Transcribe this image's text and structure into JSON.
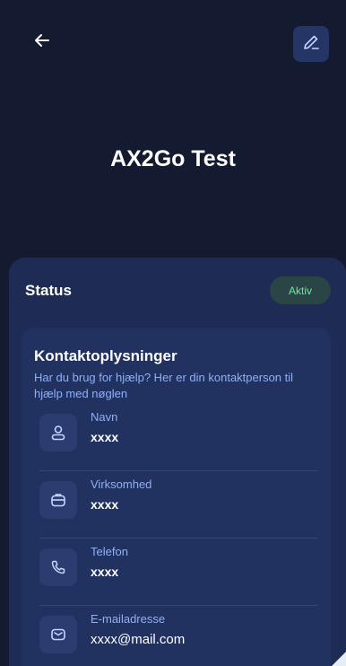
{
  "header": {
    "back_icon": "arrow-left-icon",
    "edit_icon": "pencil-icon",
    "title": "AX2Go Test"
  },
  "status": {
    "label": "Status",
    "badge": "Aktiv",
    "badge_color": "#6ee7a0"
  },
  "contact": {
    "title": "Kontaktoplysninger",
    "subtitle": "Har du brug for hjælp? Her er din kontaktperson til hjælp med nøglen",
    "items": [
      {
        "icon": "user-icon",
        "label": "Navn",
        "value": "xxxx"
      },
      {
        "icon": "briefcase-icon",
        "label": "Virksomhed",
        "value": "xxxx"
      },
      {
        "icon": "phone-icon",
        "label": "Telefon",
        "value": "xxxx"
      },
      {
        "icon": "mail-icon",
        "label": "E-mailadresse",
        "value": "xxxx@mail.com"
      }
    ]
  },
  "colors": {
    "background": "#141b30",
    "sheet": "#1e2c55",
    "card": "#223260",
    "accent_text": "#8fb0f5",
    "edit_button": "#243566"
  }
}
